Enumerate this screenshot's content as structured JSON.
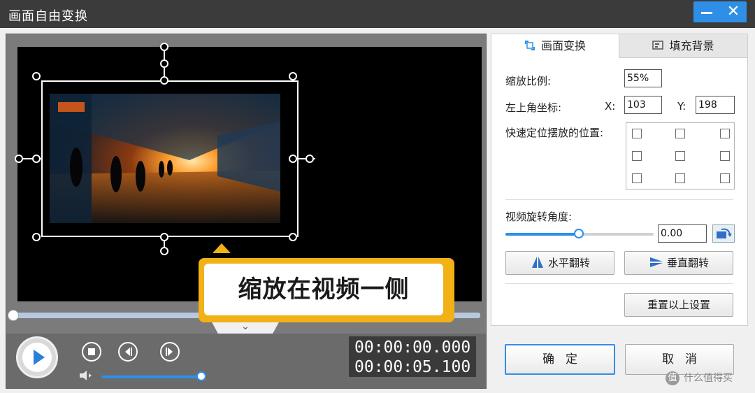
{
  "window": {
    "title": "画面自由变换",
    "minimize_glyph": "—",
    "close_glyph": "✕"
  },
  "tooltip": {
    "text": "缩放在视频一侧"
  },
  "player": {
    "collapse_glyph": "⌄",
    "current_time": "00:00:00.000",
    "total_time": "00:00:05.100",
    "volume_level": 0.95,
    "progress": 0
  },
  "tabs": [
    {
      "label": "画面变换",
      "icon": "transform-icon",
      "active": true
    },
    {
      "label": "填充背景",
      "icon": "background-icon",
      "active": false
    }
  ],
  "transform": {
    "scale_label": "缩放比例:",
    "scale_value": "55%",
    "coord_label": "左上角坐标:",
    "x_label": "X:",
    "x_value": "103",
    "y_label": "Y:",
    "y_value": "198",
    "quick_position_label": "快速定位摆放的位置:",
    "rotation_label": "视频旋转角度:",
    "rotation_value": "0.00",
    "rotation_level": 0.5,
    "flip_h_label": "水平翻转",
    "flip_v_label": "垂直翻转",
    "reset_label": "重置以上设置"
  },
  "dialog": {
    "ok_label": "确定",
    "cancel_label": "取消"
  },
  "watermark": {
    "logo": "值",
    "text": "什么值得买"
  },
  "colors": {
    "accent": "#2f8fe6",
    "tooltip": "#f2b114",
    "titlebar": "#3b3b3b"
  }
}
